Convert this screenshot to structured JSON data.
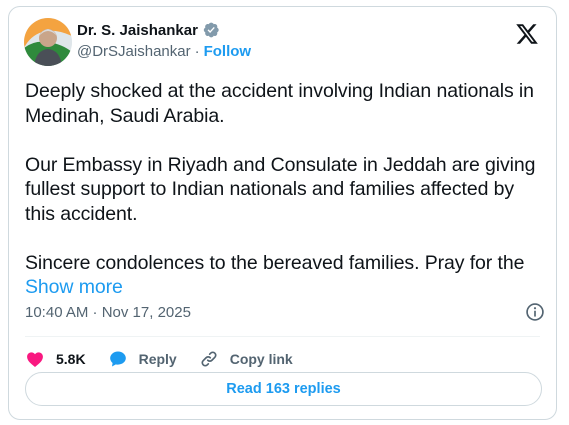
{
  "author": {
    "display_name": "Dr. S. Jaishankar",
    "handle": "@DrSJaishankar",
    "separator": "·",
    "follow_label": "Follow"
  },
  "tweet": {
    "paragraph_1": "Deeply shocked at the accident involving Indian nationals in Medinah, Saudi Arabia.",
    "paragraph_2": "Our Embassy in Riyadh and Consulate in Jeddah are giving fullest support to Indian nationals and families affected by this accident.",
    "paragraph_3": "Sincere condolences to the bereaved families. Pray for the",
    "show_more_label": "Show more"
  },
  "meta": {
    "timestamp": "10:40 AM · Nov 17, 2025"
  },
  "actions": {
    "likes_count": "5.8K",
    "reply_label": "Reply",
    "copy_link_label": "Copy link"
  },
  "read_replies_label": "Read 163 replies",
  "colors": {
    "accent": "#1d9bf0",
    "like": "#f91880",
    "verified": "#829aab",
    "text_primary": "#0f1419",
    "text_secondary": "#536471"
  },
  "icons": [
    "verified-badge-icon",
    "x-logo-icon",
    "info-icon",
    "heart-icon",
    "reply-bubble-icon",
    "link-icon"
  ]
}
